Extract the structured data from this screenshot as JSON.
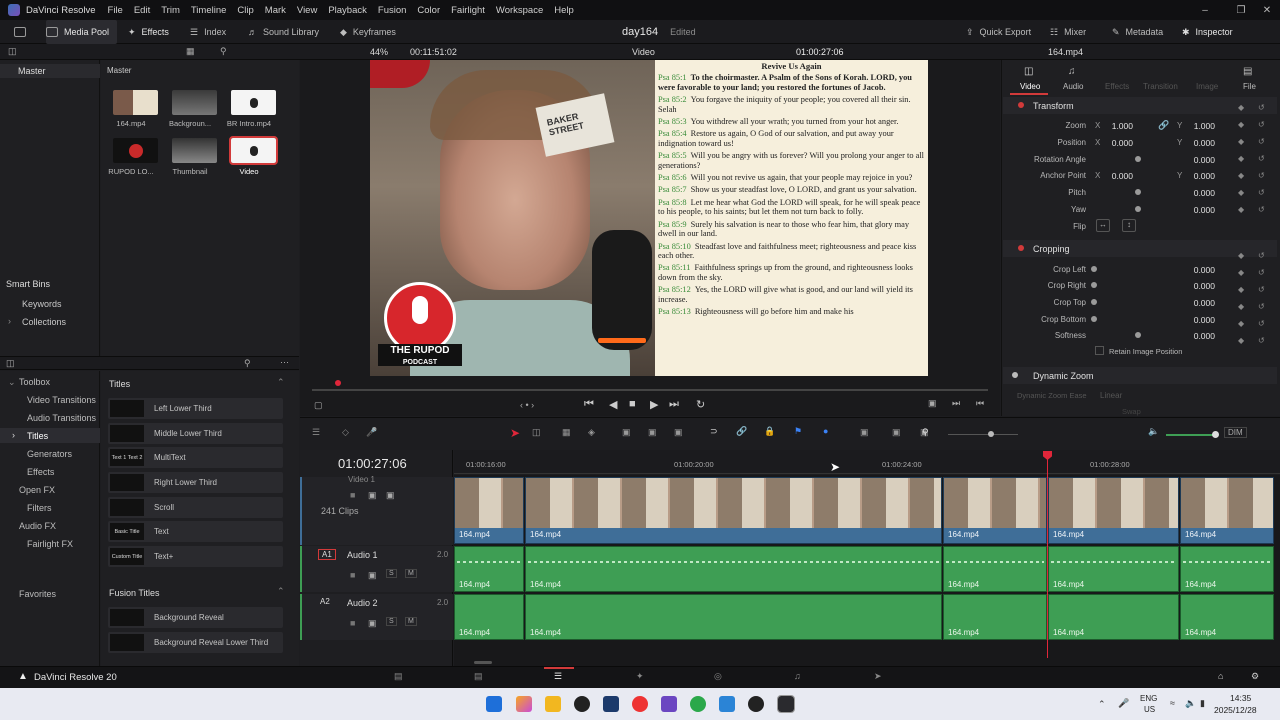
{
  "menubar": {
    "app_title": "DaVinci Resolve",
    "items": [
      "File",
      "Edit",
      "Trim",
      "Timeline",
      "Clip",
      "Mark",
      "View",
      "Playback",
      "Fusion",
      "Color",
      "Fairlight",
      "Workspace",
      "Help"
    ]
  },
  "toolbar": {
    "media_pool": "Media Pool",
    "effects": "Effects",
    "index": "Index",
    "sound_library": "Sound Library",
    "keyframes": "Keyframes",
    "project_name": "day164",
    "project_status": "Edited",
    "quick_export": "Quick Export",
    "mixer": "Mixer",
    "metadata": "Metadata",
    "inspector": "Inspector"
  },
  "viewer_bar": {
    "zoom": "44%",
    "source_tc": "00:11:51:02",
    "mode": "Video",
    "record_tc": "01:00:27:06",
    "clip_name": "164.mp4"
  },
  "media_pool": {
    "tree_root": "Master",
    "header": "Master",
    "clips": [
      {
        "name": "164.mp4"
      },
      {
        "name": "Backgroun..."
      },
      {
        "name": "BR Intro.mp4"
      },
      {
        "name": "RUPOD LO..."
      },
      {
        "name": "Thumbnail"
      },
      {
        "name": "Video"
      }
    ],
    "smart_bins": "Smart Bins",
    "smart_items": [
      "Keywords",
      "Collections"
    ]
  },
  "effects": {
    "toolbox": "Toolbox",
    "tree": [
      "Video Transitions",
      "Audio Transitions",
      "Titles",
      "Generators",
      "Effects"
    ],
    "open_fx": "Open FX",
    "filters": "Filters",
    "audio_fx": "Audio FX",
    "fairlight_fx": "Fairlight FX",
    "favorites": "Favorites",
    "titles_header": "Titles",
    "titles": [
      {
        "thumb": "",
        "label": "Left Lower Third"
      },
      {
        "thumb": "",
        "label": "Middle Lower Third"
      },
      {
        "thumb": "Text 1 Text 2",
        "label": "MultiText"
      },
      {
        "thumb": "",
        "label": "Right Lower Third"
      },
      {
        "thumb": "",
        "label": "Scroll"
      },
      {
        "thumb": "Basic Title",
        "label": "Text"
      },
      {
        "thumb": "Custom Title",
        "label": "Text+"
      }
    ],
    "fusion_header": "Fusion Titles",
    "fusion_titles": [
      {
        "label": "Background Reveal"
      },
      {
        "label": "Background Reveal Lower Third"
      }
    ]
  },
  "viewer": {
    "scripture_title": "Revive Us Again",
    "verses": [
      {
        "ref": "Psa 85:1",
        "text": "To the choirmaster. A Psalm of the Sons of Korah. LORD, you were favorable to your land; you restored the fortunes of Jacob."
      },
      {
        "ref": "Psa 85:2",
        "text": "You forgave the iniquity of your people; you covered all their sin. Selah"
      },
      {
        "ref": "Psa 85:3",
        "text": "You withdrew all your wrath; you turned from your hot anger."
      },
      {
        "ref": "Psa 85:4",
        "text": "Restore us again, O God of our salvation, and put away your indignation toward us!"
      },
      {
        "ref": "Psa 85:5",
        "text": "Will you be angry with us forever? Will you prolong your anger to all generations?"
      },
      {
        "ref": "Psa 85:6",
        "text": "Will you not revive us again, that your people may rejoice in you?"
      },
      {
        "ref": "Psa 85:7",
        "text": "Show us your steadfast love, O LORD, and grant us your salvation."
      },
      {
        "ref": "Psa 85:8",
        "text": "Let me hear what God the LORD will speak, for he will speak peace to his people, to his saints; but let them not turn back to folly."
      },
      {
        "ref": "Psa 85:9",
        "text": "Surely his salvation is near to those who fear him, that glory may dwell in our land."
      },
      {
        "ref": "Psa 85:10",
        "text": "Steadfast love and faithfulness meet; righteousness and peace kiss each other."
      },
      {
        "ref": "Psa 85:11",
        "text": "Faithfulness springs up from the ground, and righteousness looks down from the sky."
      },
      {
        "ref": "Psa 85:12",
        "text": "Yes, the LORD will give what is good, and our land will yield its increase."
      },
      {
        "ref": "Psa 85:13",
        "text": "Righteousness will go before him and make his"
      }
    ],
    "logo_line1": "THE RUPOD",
    "logo_line2": "PODCAST",
    "poster_text": "BAKER STREET"
  },
  "inspector": {
    "tabs": [
      "Video",
      "Audio",
      "Effects",
      "Transition",
      "Image",
      "File"
    ],
    "transform": "Transform",
    "zoom_label": "Zoom",
    "zoom_x": "1.000",
    "zoom_y": "1.000",
    "position_label": "Position",
    "position_x": "0.000",
    "position_y": "0.000",
    "rotation_label": "Rotation Angle",
    "rotation": "0.000",
    "anchor_label": "Anchor Point",
    "anchor_x": "0.000",
    "anchor_y": "0.000",
    "pitch_label": "Pitch",
    "pitch": "0.000",
    "yaw_label": "Yaw",
    "yaw": "0.000",
    "flip_label": "Flip",
    "x": "X",
    "y": "Y",
    "cropping": "Cropping",
    "crop_left_label": "Crop Left",
    "crop_left": "0.000",
    "crop_right_label": "Crop Right",
    "crop_right": "0.000",
    "crop_top_label": "Crop Top",
    "crop_top": "0.000",
    "crop_bottom_label": "Crop Bottom",
    "crop_bottom": "0.000",
    "softness_label": "Softness",
    "softness": "0.000",
    "retain": "Retain Image Position",
    "dynamic_zoom": "Dynamic Zoom",
    "dz_ease_label": "Dynamic Zoom Ease",
    "dz_ease_value": "Linear",
    "swap": "Swap"
  },
  "timeline": {
    "timecode": "01:00:27:06",
    "ruler": [
      "01:00:16:00",
      "01:00:20:00",
      "01:00:24:00",
      "01:00:28:00"
    ],
    "video_track_name": "Video 1",
    "clip_count": "241 Clips",
    "a1_badge": "A1",
    "a1_name": "Audio 1",
    "a1_ch": "2.0",
    "a2_badge": "A2",
    "a2_name": "Audio 2",
    "a2_ch": "2.0",
    "s": "S",
    "m": "M",
    "clip_label": "164.mp4",
    "dim": "DIM"
  },
  "pagebar": {
    "brand": "DaVinci Resolve 20"
  },
  "taskbar": {
    "lang1": "ENG",
    "lang2": "US",
    "time": "14:35",
    "date": "2025/12/28"
  },
  "colors": {
    "playhead": "#e0263a",
    "video_clip": "#3f6e98",
    "audio_clip": "#3e9e54",
    "accent": "#d23a3a"
  }
}
